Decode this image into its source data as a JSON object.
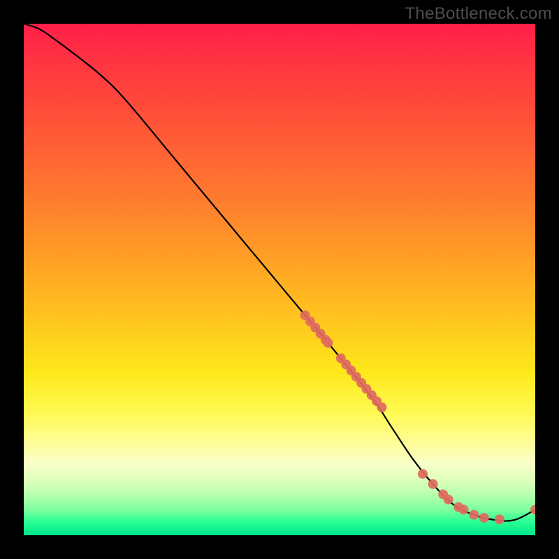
{
  "watermark": "TheBottleneck.com",
  "chart_data": {
    "type": "line",
    "title": "",
    "xlabel": "",
    "ylabel": "",
    "xlim": [
      0,
      100
    ],
    "ylim": [
      0,
      100
    ],
    "grid": false,
    "series": [
      {
        "name": "curve",
        "style": "line",
        "color": "#000000",
        "x": [
          0,
          3,
          6,
          10,
          15,
          20,
          30,
          40,
          50,
          60,
          68,
          72,
          76,
          80,
          84,
          88,
          92,
          96,
          100
        ],
        "y": [
          100,
          99,
          97,
          94,
          90,
          85,
          73,
          61,
          49,
          37,
          27,
          21,
          15,
          10,
          6,
          4,
          3,
          3,
          5
        ]
      },
      {
        "name": "points",
        "style": "scatter",
        "color": "#e06a5e",
        "x": [
          55,
          56,
          57,
          58,
          59,
          59.5,
          62,
          63,
          64,
          65,
          66,
          67,
          68,
          69,
          70,
          78,
          80,
          82,
          83,
          85,
          86,
          88,
          90,
          93,
          100
        ],
        "y": [
          43,
          41.8,
          40.6,
          39.4,
          38.2,
          37.6,
          34.6,
          33.4,
          32.2,
          31,
          29.8,
          28.6,
          27.4,
          26.2,
          25,
          12,
          10,
          8,
          7,
          5.5,
          5,
          4,
          3.4,
          3.1,
          5
        ]
      }
    ]
  }
}
